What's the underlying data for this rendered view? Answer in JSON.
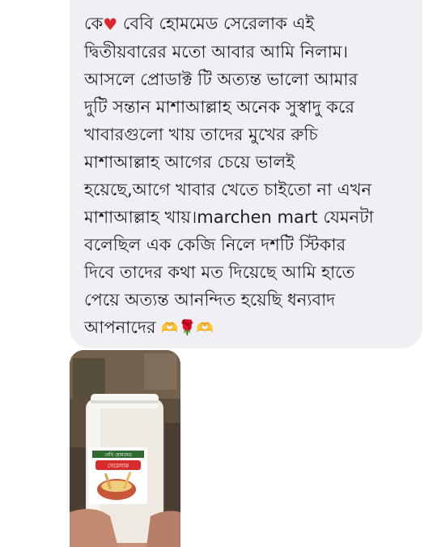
{
  "message": {
    "lines": [
      "কে",
      "বেবি হোমমেড সেরেলাক এই",
      "দ্বিতীয়বারের মতো আবার আমি নিলাম।",
      "আসলে প্রোডাক্ট টি অত্যন্ত ভালো আমার",
      "দুটি সন্তান মাশাআল্লাহ অনেক সুস্বাদু করে",
      "খাবারগুলো খায় তাদের মুখের রুচি",
      "মাশাআল্লাহ আগের চেয়ে ভালই",
      "হয়েছে,আগে খাবার খেতে চাইতো না এখন",
      "মাশাআল্লাহ খায়।marchen mart যেমনটা",
      "বলেছিল এক কেজি নিলে দশটি স্টিকার",
      "দিবে তাদের কথা মত দিয়েছে আমি হাতে",
      "পেয়ে অত্যন্ত আনন্দিত হয়েছি ধন্যবাদ",
      "আপনাদের"
    ],
    "emoji_heart": "♥",
    "emoji_hands": "🫶",
    "emoji_rose": "🌹"
  },
  "photo": {
    "jar_label_line1": "বেবি হোমমেড",
    "jar_label_line2": "সেরেলাক"
  },
  "colors": {
    "bubble": "#f0f0f4",
    "text": "#1c1e21",
    "heart": "#e0242c",
    "jar_label_red": "#d62c2c"
  }
}
